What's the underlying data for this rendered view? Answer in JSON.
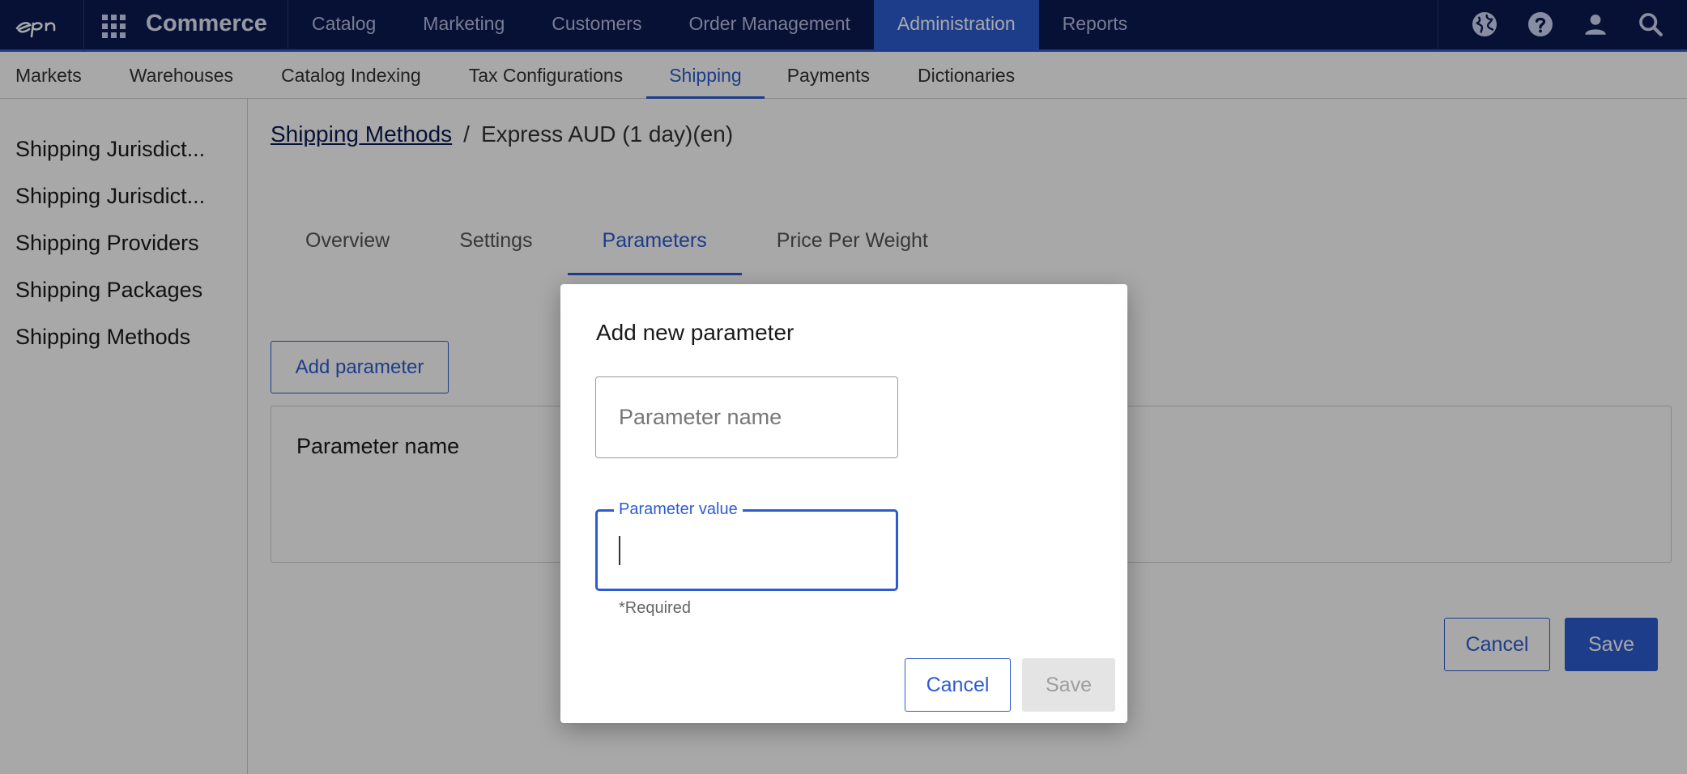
{
  "app": {
    "brand": "Commerce"
  },
  "topnav": {
    "items": [
      {
        "label": "Catalog",
        "active": false
      },
      {
        "label": "Marketing",
        "active": false
      },
      {
        "label": "Customers",
        "active": false
      },
      {
        "label": "Order Management",
        "active": false
      },
      {
        "label": "Administration",
        "active": true
      },
      {
        "label": "Reports",
        "active": false
      }
    ],
    "icons": [
      "globe-icon",
      "help-icon",
      "user-icon",
      "search-icon"
    ]
  },
  "subnav": {
    "items": [
      {
        "label": "Markets",
        "active": false
      },
      {
        "label": "Warehouses",
        "active": false
      },
      {
        "label": "Catalog Indexing",
        "active": false
      },
      {
        "label": "Tax Configurations",
        "active": false
      },
      {
        "label": "Shipping",
        "active": true
      },
      {
        "label": "Payments",
        "active": false
      },
      {
        "label": "Dictionaries",
        "active": false
      }
    ]
  },
  "sidebar": {
    "items": [
      {
        "label": "Shipping Jurisdict..."
      },
      {
        "label": "Shipping Jurisdict..."
      },
      {
        "label": "Shipping Providers"
      },
      {
        "label": "Shipping Packages"
      },
      {
        "label": "Shipping Methods"
      }
    ]
  },
  "breadcrumb": {
    "parent": "Shipping Methods",
    "separator": "/",
    "current": "Express AUD (1 day)(en)"
  },
  "tabs": {
    "items": [
      {
        "label": "Overview",
        "active": false
      },
      {
        "label": "Settings",
        "active": false
      },
      {
        "label": "Parameters",
        "active": true
      },
      {
        "label": "Price Per Weight",
        "active": false
      }
    ]
  },
  "main": {
    "add_parameter_label": "Add parameter",
    "grid_header": "Parameter name",
    "cancel_label": "Cancel",
    "save_label": "Save"
  },
  "dialog": {
    "title": "Add new parameter",
    "name_placeholder": "Parameter name",
    "name_value": "",
    "value_label": "Parameter value",
    "value_value": "",
    "helper": "*Required",
    "cancel_label": "Cancel",
    "save_label": "Save"
  },
  "colors": {
    "nav_bg": "#0b1a52",
    "accent": "#2d5bd2"
  }
}
